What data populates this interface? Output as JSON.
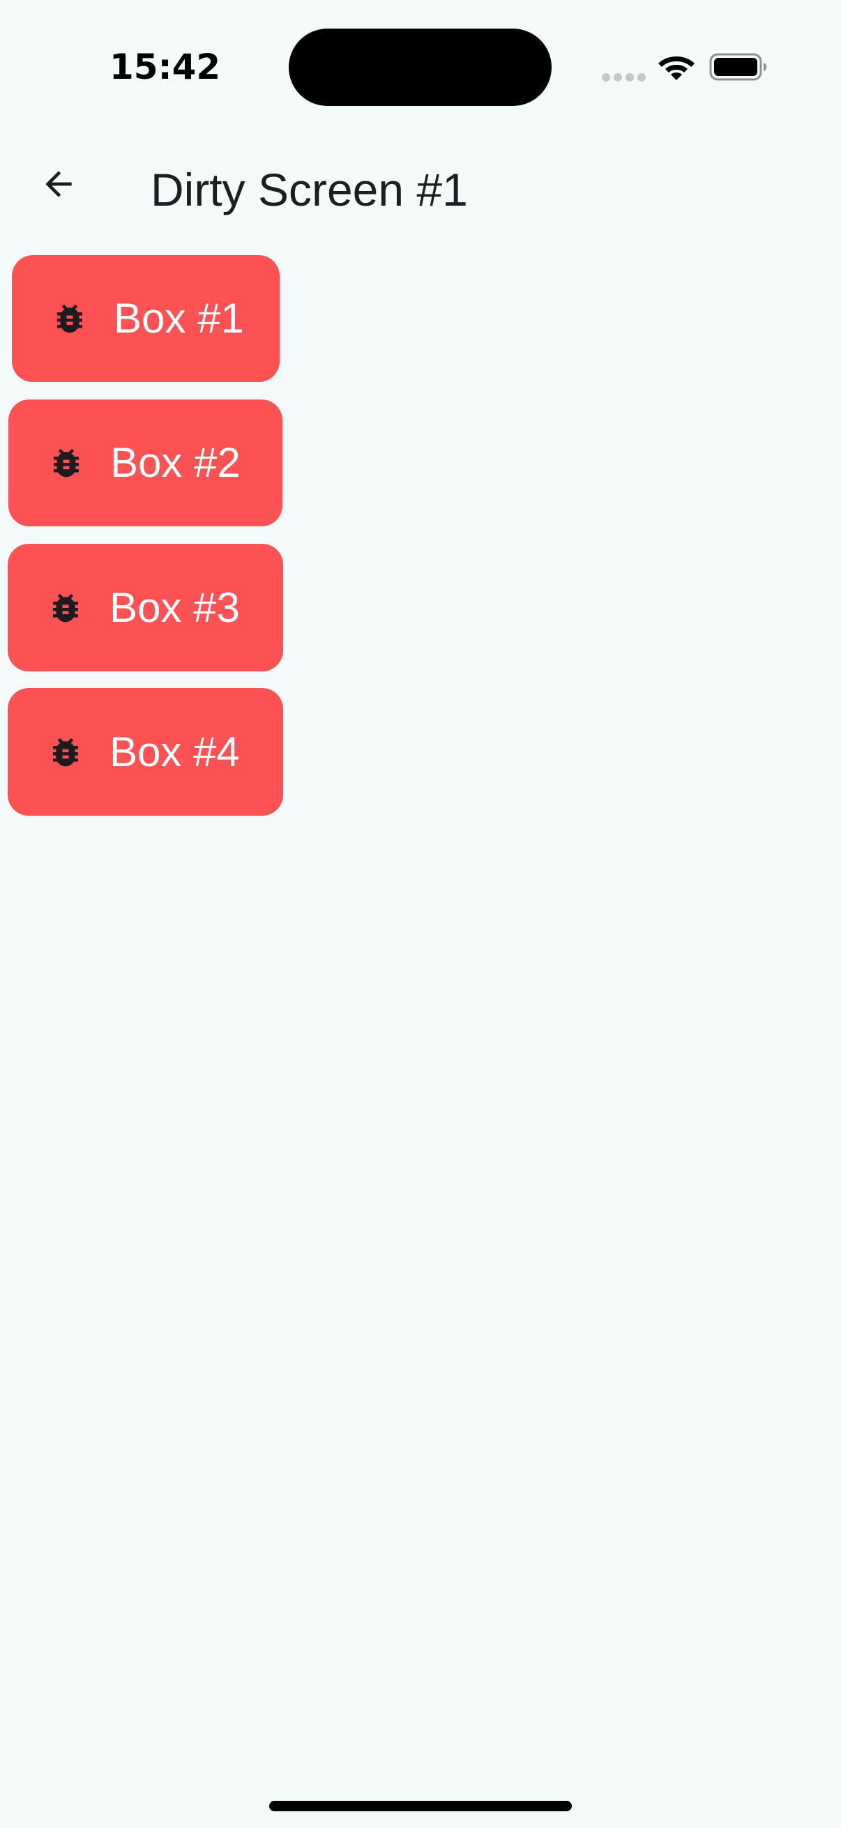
{
  "status_bar": {
    "time": "15:42",
    "icons": [
      "signal-dots-icon",
      "wifi-icon",
      "battery-icon"
    ]
  },
  "app_bar": {
    "back_icon": "arrow-left-icon",
    "title": "Dirty Screen #1"
  },
  "boxes": [
    {
      "label": "Box #1",
      "icon": "bug-icon"
    },
    {
      "label": "Box #2",
      "icon": "bug-icon"
    },
    {
      "label": "Box #3",
      "icon": "bug-icon"
    },
    {
      "label": "Box #4",
      "icon": "bug-icon"
    }
  ],
  "colors": {
    "background": "#f4f9fa",
    "box": "#fc5254",
    "box_text": "#ffffff",
    "icon": "#1c1b1f",
    "title_text": "#1b1f21"
  }
}
